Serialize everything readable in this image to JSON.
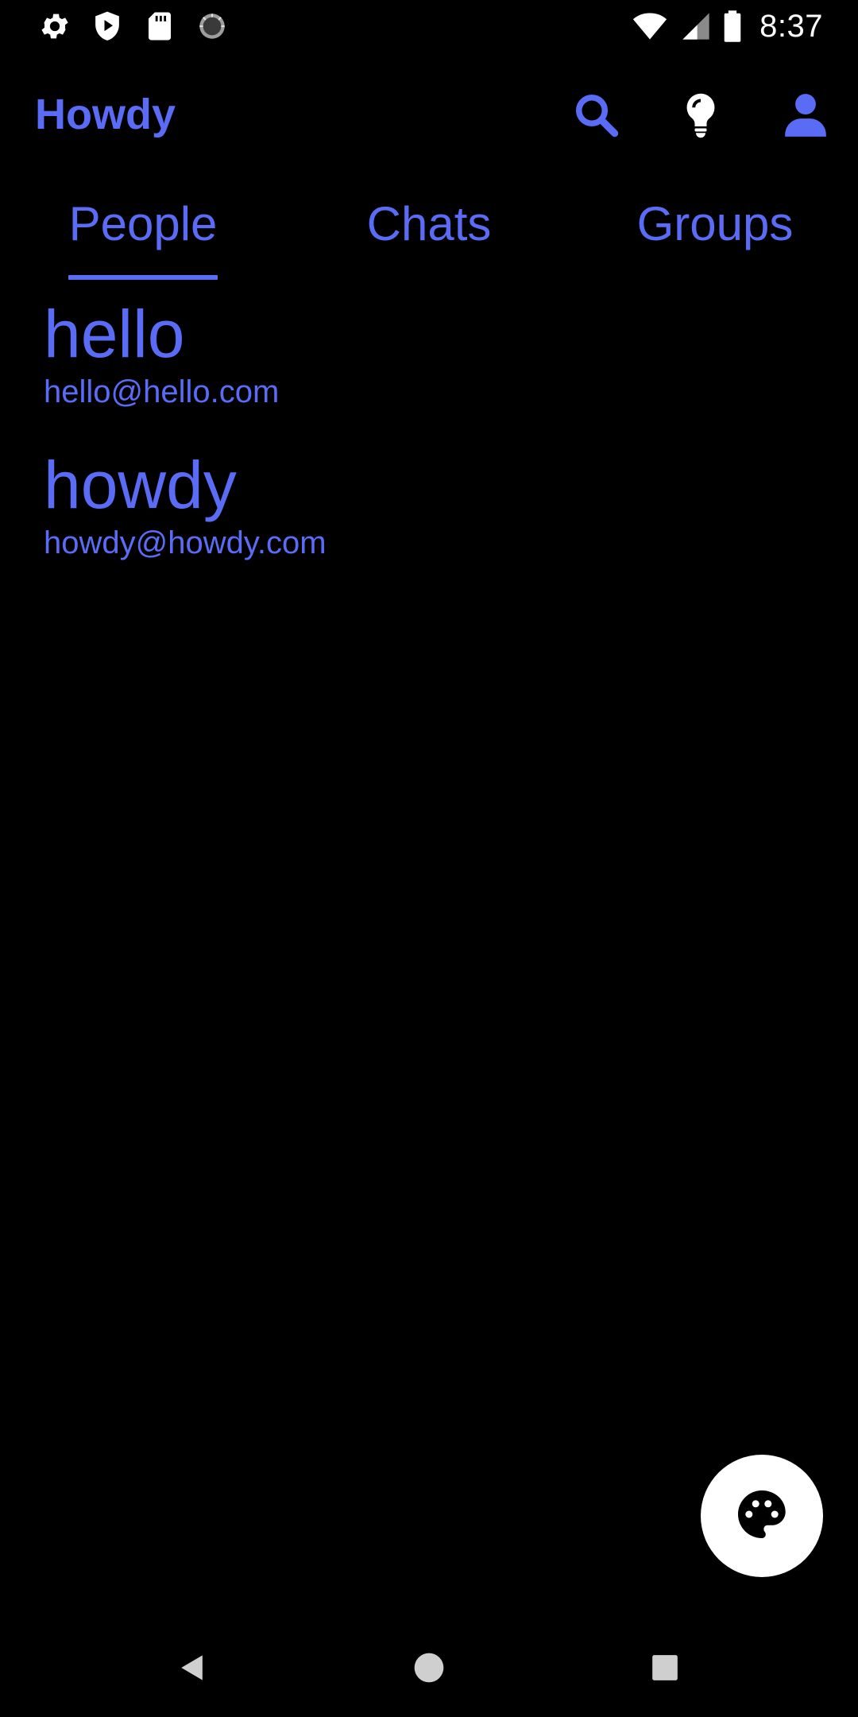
{
  "status_bar": {
    "time": "8:37",
    "left_icons": [
      "gear-icon",
      "shield-play-icon",
      "sd-card-icon",
      "sync-spinner-icon"
    ],
    "right_icons": [
      "wifi-icon",
      "cell-signal-icon",
      "battery-icon"
    ]
  },
  "app_bar": {
    "title": "Howdy",
    "actions": [
      "search-icon",
      "lightbulb-icon",
      "account-icon"
    ]
  },
  "tabs": [
    {
      "label": "People",
      "selected": true
    },
    {
      "label": "Chats",
      "selected": false
    },
    {
      "label": "Groups",
      "selected": false
    }
  ],
  "people": [
    {
      "name": "hello",
      "email": "hello@hello.com"
    },
    {
      "name": "howdy",
      "email": "howdy@howdy.com"
    }
  ],
  "fab": {
    "icon": "palette-icon"
  },
  "nav_bar": {
    "buttons": [
      "back-icon",
      "home-icon",
      "recents-icon"
    ]
  },
  "colors": {
    "accent": "#5a6cf6",
    "background": "#000000",
    "fab_background": "#ffffff",
    "status_icons": "#ffffff"
  }
}
